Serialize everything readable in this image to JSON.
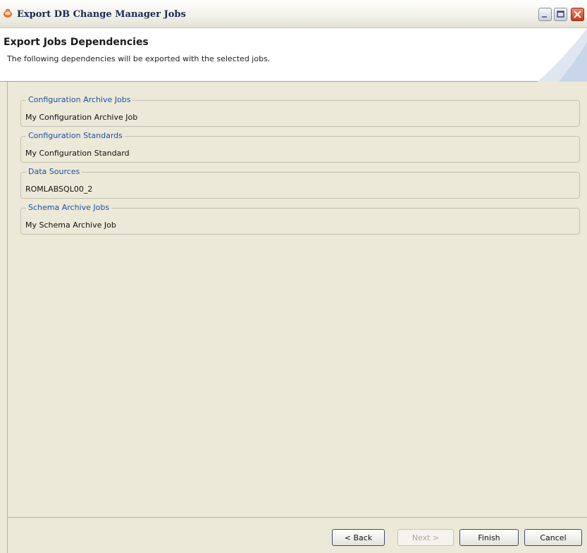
{
  "window": {
    "title": "Export DB Change Manager Jobs"
  },
  "header": {
    "title": "Export Jobs Dependencies",
    "description": "The following dependencies will be exported with the selected jobs."
  },
  "groups": [
    {
      "title": "Configuration Archive Jobs",
      "value": "My Configuration Archive Job"
    },
    {
      "title": "Configuration Standards",
      "value": "My Configuration Standard"
    },
    {
      "title": "Data Sources",
      "value": "ROMLABSQL00_2"
    },
    {
      "title": "Schema Archive Jobs",
      "value": "My Schema Archive Job"
    }
  ],
  "buttons": {
    "back": "< Back",
    "next": "Next >",
    "finish": "Finish",
    "cancel": "Cancel"
  },
  "colors": {
    "group_title": "#1f4da8",
    "window_bg": "#ece9d8"
  }
}
